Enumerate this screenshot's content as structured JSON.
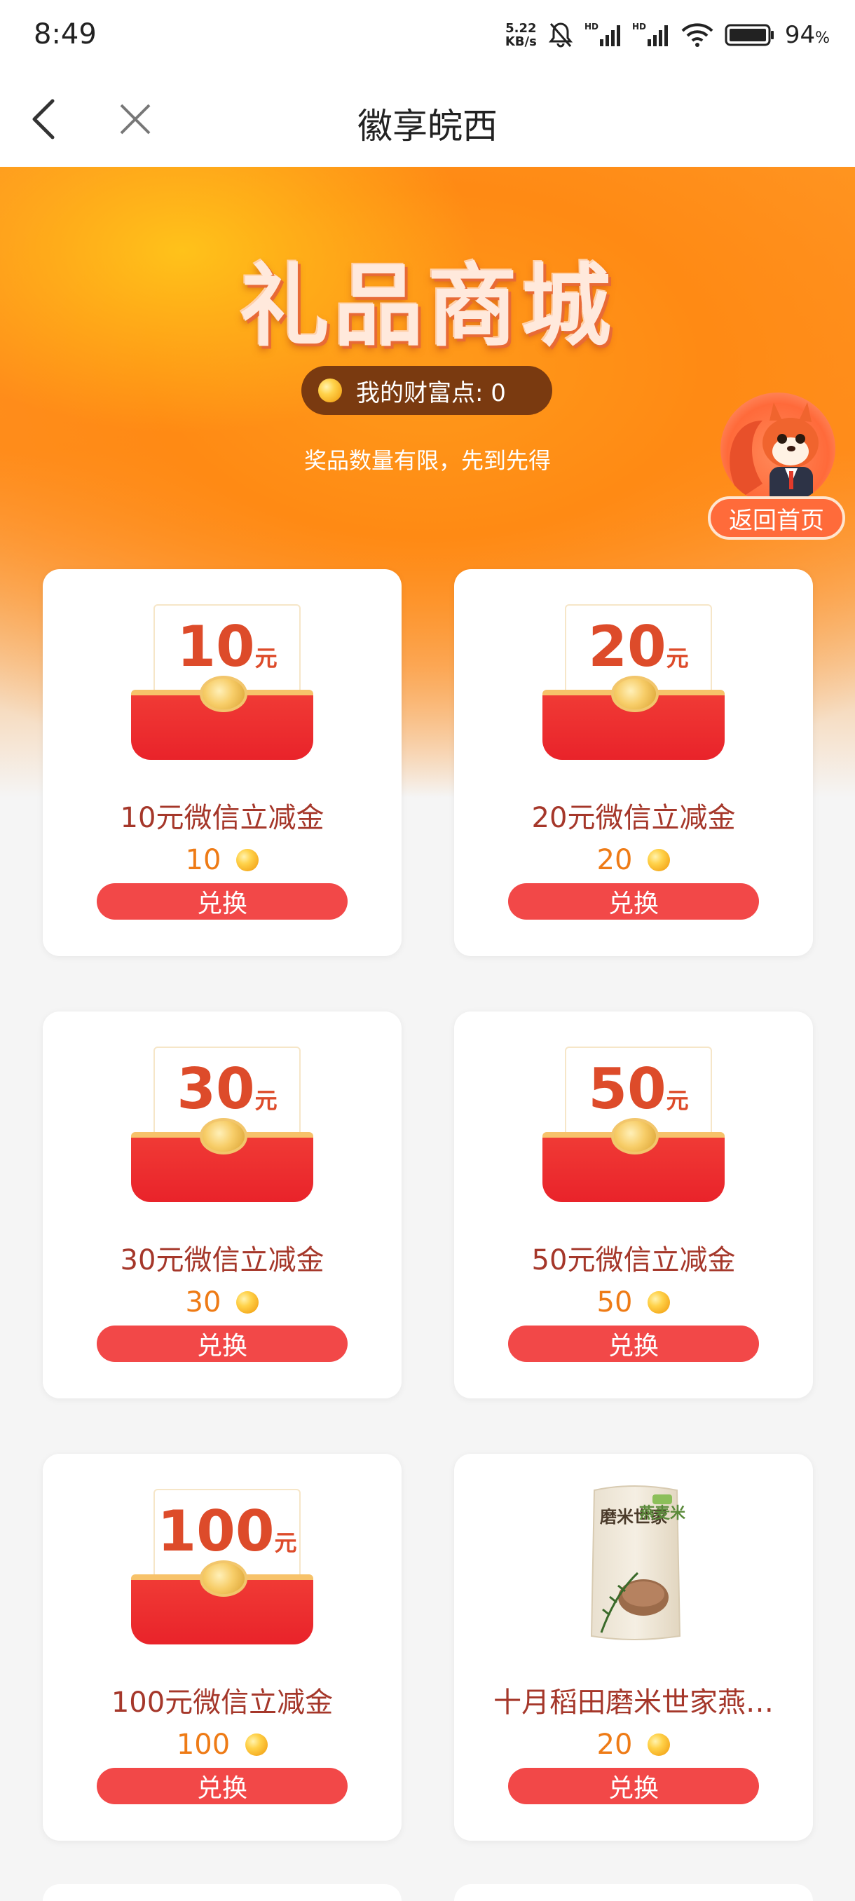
{
  "status_bar": {
    "time": "8:49",
    "net_speed_value": "5.22",
    "net_speed_unit": "KB/s",
    "hd1": "HD",
    "hd2": "HD",
    "battery": "94",
    "battery_unit": "%"
  },
  "header": {
    "title": "徽享皖西"
  },
  "hero": {
    "title": "礼品商城",
    "wealth_label": "我的财富点: 0",
    "note": "奖品数量有限，先到先得",
    "return_home": "返回首页"
  },
  "products": [
    {
      "amount": "10",
      "unit": "元",
      "name": "10元微信立减金",
      "price": "10",
      "button": "兑换"
    },
    {
      "amount": "20",
      "unit": "元",
      "name": "20元微信立减金",
      "price": "20",
      "button": "兑换"
    },
    {
      "amount": "30",
      "unit": "元",
      "name": "30元微信立减金",
      "price": "30",
      "button": "兑换"
    },
    {
      "amount": "50",
      "unit": "元",
      "name": "50元微信立减金",
      "price": "50",
      "button": "兑换"
    },
    {
      "amount": "100",
      "unit": "元",
      "name": "100元微信立减金",
      "price": "100",
      "button": "兑换"
    },
    {
      "name": "十月稻田磨米世家燕…",
      "price": "20",
      "button": "兑换",
      "image_text_1": "磨米世家",
      "image_text_2": "燕麦米"
    }
  ],
  "colors": {
    "accent": "#ff8e1a",
    "button": "#f24848",
    "product_name": "#a5372a",
    "price": "#ee7b16"
  }
}
